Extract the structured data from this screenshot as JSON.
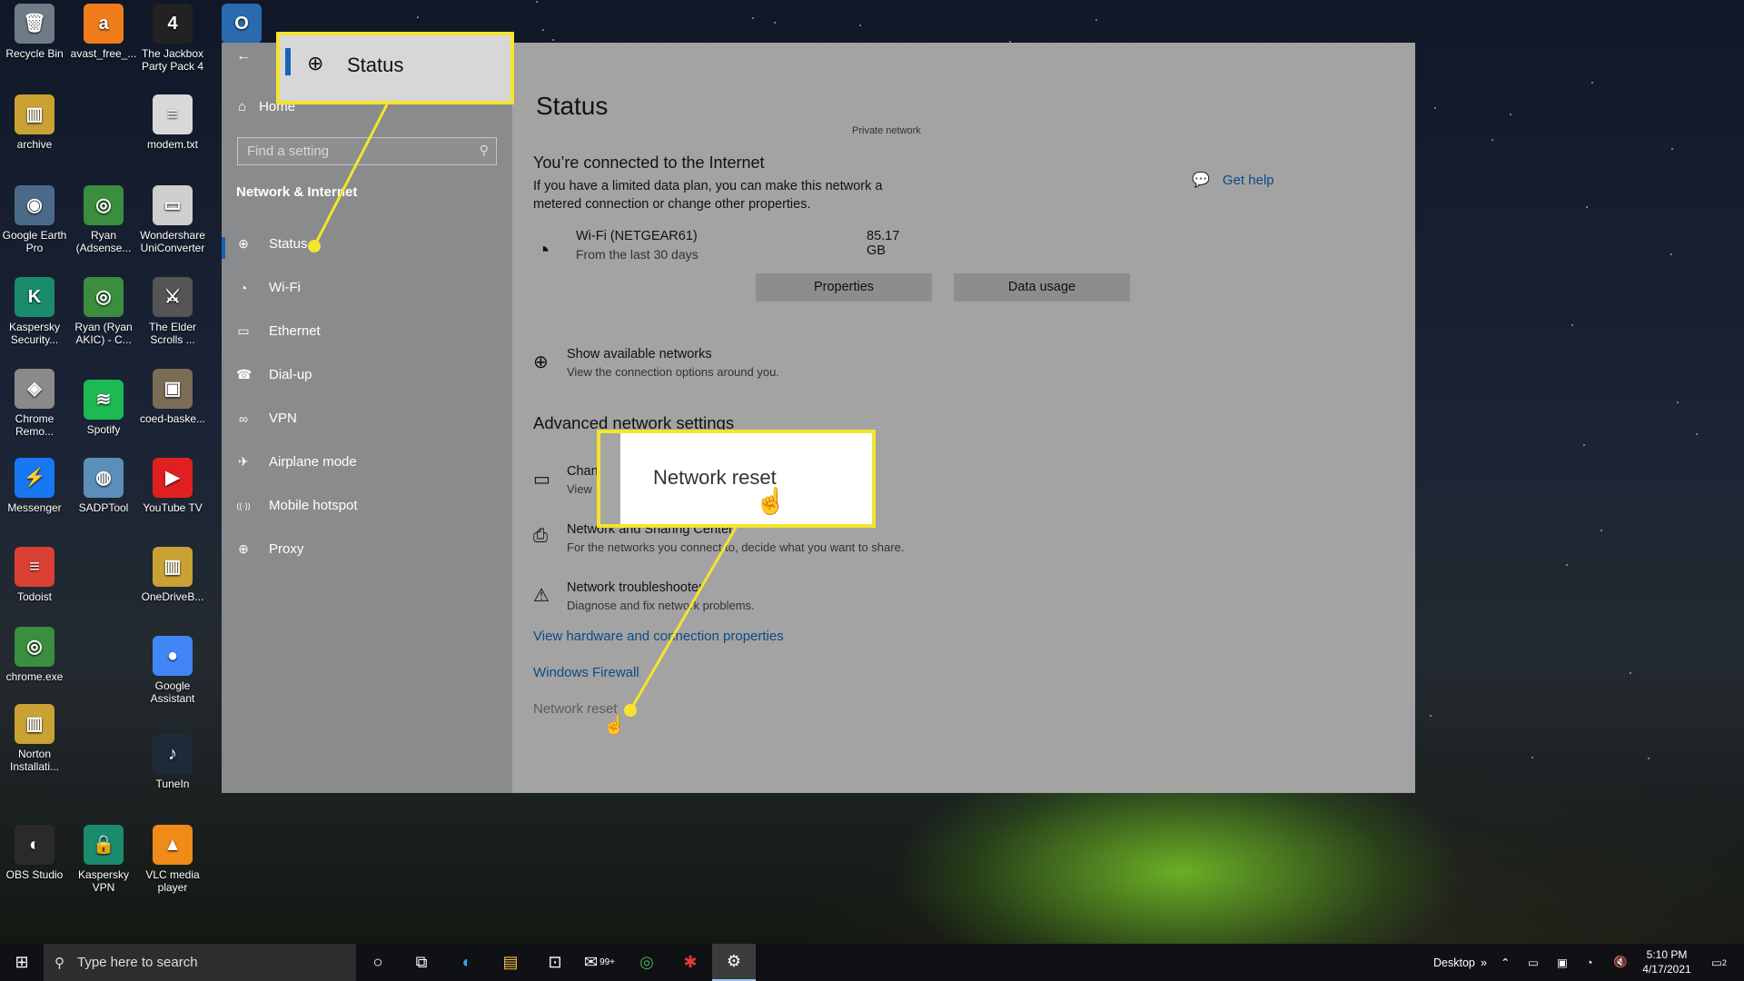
{
  "desktop": {
    "icons": [
      {
        "label": "Recycle Bin",
        "glyph": "🗑",
        "color": "#6f7c86"
      },
      {
        "label": "avast_free_...",
        "glyph": "a",
        "color": "#f07c1c"
      },
      {
        "label": "The Jackbox Party Pack 4",
        "glyph": "4",
        "color": "#222"
      },
      {
        "label": "O",
        "glyph": "O",
        "color": "#2a6bb0"
      },
      {
        "label": "archive",
        "glyph": "▥",
        "color": "#c9a233"
      },
      {
        "label": "modem.txt",
        "glyph": "≡",
        "color": "#d8d8d8"
      },
      {
        "label": "Google Earth Pro",
        "glyph": "◉",
        "color": "#4b6a88"
      },
      {
        "label": "Ryan (Adsense...",
        "glyph": "◎",
        "color": "#3a8e3d"
      },
      {
        "label": "Wondershare UniConverter",
        "glyph": "▭",
        "color": "#cfcfcf"
      },
      {
        "label": "Kaspersky Security...",
        "glyph": "K",
        "color": "#1b8b6e"
      },
      {
        "label": "Ryan (Ryan AKIC) - C...",
        "glyph": "◎",
        "color": "#3a8e3d"
      },
      {
        "label": "The Elder Scrolls ...",
        "glyph": "⚔",
        "color": "#555"
      },
      {
        "label": "Chrome Remo...",
        "glyph": "◈",
        "color": "#8a8a8a"
      },
      {
        "label": "Spotify",
        "glyph": "≋",
        "color": "#1db954"
      },
      {
        "label": "coed-baske...",
        "glyph": "▣",
        "color": "#7a6c55"
      },
      {
        "label": "Messenger",
        "glyph": "⚡",
        "color": "#1877f2"
      },
      {
        "label": "SADPTool",
        "glyph": "◍",
        "color": "#5b8fb9"
      },
      {
        "label": "YouTube TV",
        "glyph": "▶",
        "color": "#e02020"
      },
      {
        "label": "Todoist",
        "glyph": "≡",
        "color": "#db4035"
      },
      {
        "label": "OneDriveB...",
        "glyph": "▥",
        "color": "#c9a233"
      },
      {
        "label": "chrome.exe",
        "glyph": "◎",
        "color": "#3a8e3d"
      },
      {
        "label": "Google Assistant",
        "glyph": "●",
        "color": "#4285f4"
      },
      {
        "label": "Norton Installati...",
        "glyph": "▥",
        "color": "#c9a233"
      },
      {
        "label": "TuneIn",
        "glyph": "♪",
        "color": "#1c2a3a"
      },
      {
        "label": "OBS Studio",
        "glyph": "◐",
        "color": "#2a2a2a"
      },
      {
        "label": "Kaspersky VPN",
        "glyph": "🔒",
        "color": "#1b8b6e"
      },
      {
        "label": "VLC media player",
        "glyph": "▲",
        "color": "#f08a18"
      }
    ]
  },
  "window": {
    "controls": {
      "minimize": "—",
      "maximize": "☐",
      "close": "✕"
    },
    "back": "←"
  },
  "sidebar": {
    "home_label": "Home",
    "home_icon": "home-icon",
    "search_placeholder": "Find a setting",
    "section_title": "Network & Internet",
    "items": [
      {
        "label": "Status",
        "icon": "globe-icon",
        "glyph": "⊕"
      },
      {
        "label": "Wi-Fi",
        "icon": "wifi-icon",
        "glyph": "◔"
      },
      {
        "label": "Ethernet",
        "icon": "ethernet-icon",
        "glyph": "▭"
      },
      {
        "label": "Dial-up",
        "icon": "dialup-icon",
        "glyph": "☎"
      },
      {
        "label": "VPN",
        "icon": "vpn-icon",
        "glyph": "∞"
      },
      {
        "label": "Airplane mode",
        "icon": "airplane-icon",
        "glyph": "✈"
      },
      {
        "label": "Mobile hotspot",
        "icon": "hotspot-icon",
        "glyph": "((·))"
      },
      {
        "label": "Proxy",
        "icon": "proxy-icon",
        "glyph": "⊕"
      }
    ]
  },
  "main": {
    "title": "Status",
    "network_type": "Private network",
    "connected_heading": "You’re connected to the Internet",
    "connected_desc": "If you have a limited data plan, you can make this network a metered connection or change other properties.",
    "network": {
      "name": "Wi-Fi (NETGEAR61)",
      "period": "From the last 30 days",
      "usage": "85.17 GB"
    },
    "properties_button": "Properties",
    "data_usage_button": "Data usage",
    "show_networks": {
      "title": "Show available networks",
      "desc": "View the connection options around you."
    },
    "advanced_heading": "Advanced network settings",
    "change_adapter": {
      "title": "Chan",
      "desc": "View"
    },
    "sharing_center": {
      "title": "Network and Sharing Center",
      "desc": "For the networks you connect to, decide what you want to share."
    },
    "troubleshooter": {
      "title": "Network troubleshooter",
      "desc": "Diagnose and fix network problems."
    },
    "link_hardware": "View hardware and connection properties",
    "link_firewall": "Windows Firewall",
    "link_reset": "Network reset",
    "get_help": "Get help"
  },
  "callouts": {
    "status_label": "Status",
    "reset_label": "Network reset",
    "color": "#f5e42d"
  },
  "taskbar": {
    "search_placeholder": "Type here to search",
    "mail_badge": "99+",
    "desktop_label": "Desktop",
    "time": "5:10 PM",
    "date": "4/17/2021",
    "notification_count": "2"
  }
}
